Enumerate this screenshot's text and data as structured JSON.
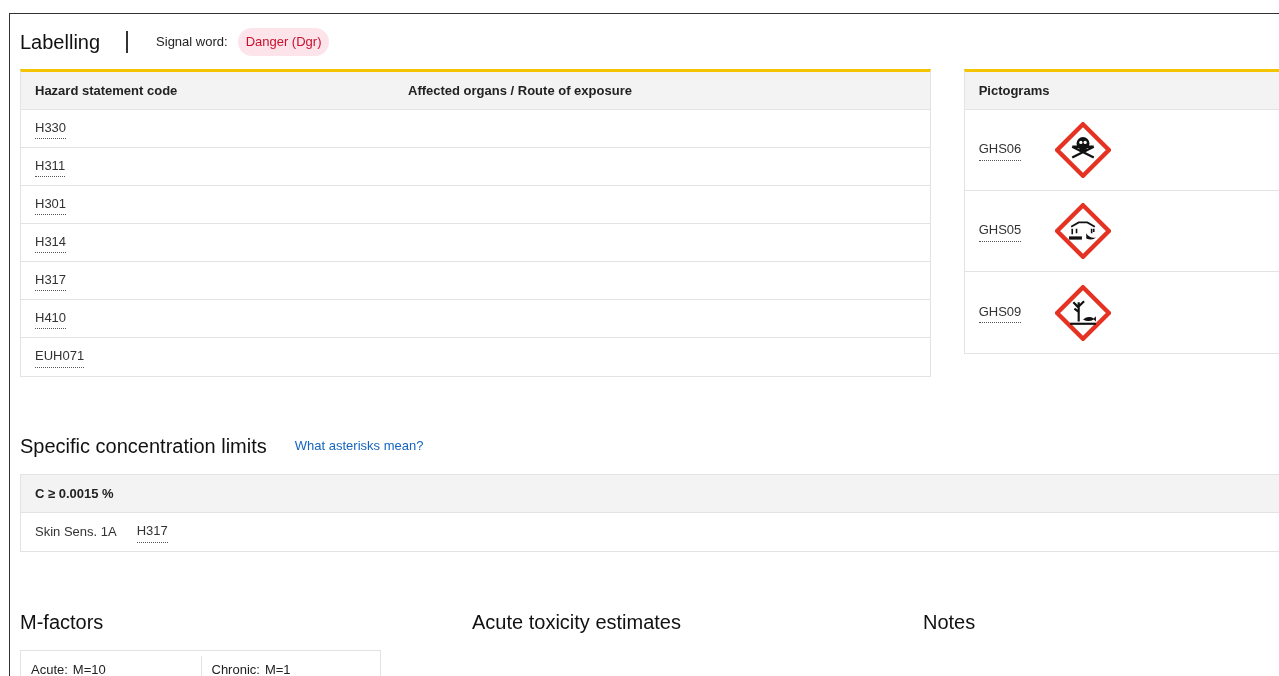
{
  "labelling": {
    "title": "Labelling",
    "signal_word_label": "Signal word:",
    "signal_word": "Danger (Dgr)"
  },
  "hazard_table": {
    "columns": [
      "Hazard statement code",
      "Affected organs / Route of exposure"
    ],
    "rows": [
      {
        "code": "H330"
      },
      {
        "code": "H311"
      },
      {
        "code": "H301"
      },
      {
        "code": "H314"
      },
      {
        "code": "H317"
      },
      {
        "code": "H410"
      },
      {
        "code": "EUH071"
      }
    ]
  },
  "pictograms": {
    "column": "Pictograms",
    "items": [
      {
        "code": "GHS06",
        "kind": "skull"
      },
      {
        "code": "GHS05",
        "kind": "corrosion"
      },
      {
        "code": "GHS09",
        "kind": "environment"
      }
    ]
  },
  "concentration_limits": {
    "title": "Specific concentration limits",
    "link": "What asterisks mean?",
    "header": "C ≥ 0.0015 %",
    "classification": "Skin Sens. 1A",
    "code": "H317"
  },
  "m_factors": {
    "title": "M-factors",
    "items": [
      {
        "label": "Acute:",
        "value": "M=10"
      },
      {
        "label": "Chronic:",
        "value": "M=1"
      }
    ]
  },
  "acute_toxicity": {
    "title": "Acute toxicity estimates"
  },
  "notes": {
    "title": "Notes"
  }
}
